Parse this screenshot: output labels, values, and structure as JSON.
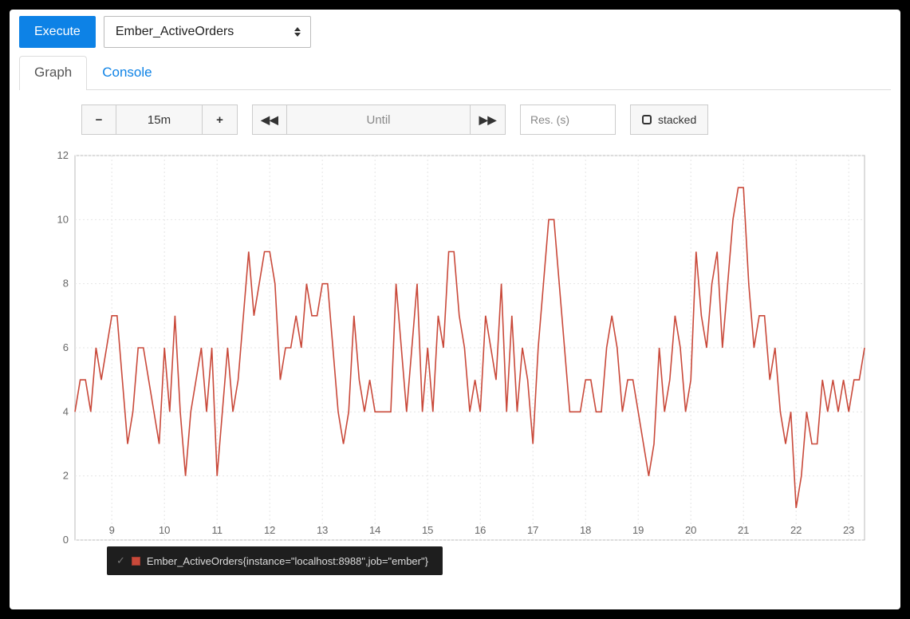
{
  "toolbar": {
    "execute_label": "Execute",
    "query_selected": "Ember_ActiveOrders"
  },
  "tabs": {
    "graph": "Graph",
    "console": "Console",
    "active": "graph"
  },
  "controls": {
    "range_value": "15m",
    "until_placeholder": "Until",
    "res_placeholder": "Res. (s)",
    "stacked_label": "stacked"
  },
  "legend": {
    "series_label": "Ember_ActiveOrders{instance=\"localhost:8988\",job=\"ember\"}"
  },
  "chart_data": {
    "type": "line",
    "title": "",
    "xlabel": "",
    "ylabel": "",
    "ylim": [
      0,
      12
    ],
    "x_ticks": [
      9,
      10,
      11,
      12,
      13,
      14,
      15,
      16,
      17,
      18,
      19,
      20,
      21,
      22,
      23
    ],
    "series": [
      {
        "name": "Ember_ActiveOrders{instance=\"localhost:8988\",job=\"ember\"}",
        "color": "#c9493a",
        "x": [
          8.3,
          8.4,
          8.5,
          8.6,
          8.7,
          8.8,
          8.9,
          9.0,
          9.1,
          9.2,
          9.3,
          9.4,
          9.5,
          9.6,
          9.7,
          9.8,
          9.9,
          10.0,
          10.1,
          10.2,
          10.3,
          10.4,
          10.5,
          10.6,
          10.7,
          10.8,
          10.9,
          11.0,
          11.1,
          11.2,
          11.3,
          11.4,
          11.5,
          11.6,
          11.7,
          11.8,
          11.9,
          12.0,
          12.1,
          12.2,
          12.3,
          12.4,
          12.5,
          12.6,
          12.7,
          12.8,
          12.9,
          13.0,
          13.1,
          13.2,
          13.3,
          13.4,
          13.5,
          13.6,
          13.7,
          13.8,
          13.9,
          14.0,
          14.1,
          14.2,
          14.3,
          14.4,
          14.5,
          14.6,
          14.7,
          14.8,
          14.9,
          15.0,
          15.1,
          15.2,
          15.3,
          15.4,
          15.5,
          15.6,
          15.7,
          15.8,
          15.9,
          16.0,
          16.1,
          16.2,
          16.3,
          16.4,
          16.5,
          16.6,
          16.7,
          16.8,
          16.9,
          17.0,
          17.1,
          17.2,
          17.3,
          17.4,
          17.5,
          17.6,
          17.7,
          17.8,
          17.9,
          18.0,
          18.1,
          18.2,
          18.3,
          18.4,
          18.5,
          18.6,
          18.7,
          18.8,
          18.9,
          19.0,
          19.1,
          19.2,
          19.3,
          19.4,
          19.5,
          19.6,
          19.7,
          19.8,
          19.9,
          20.0,
          20.1,
          20.2,
          20.3,
          20.4,
          20.5,
          20.6,
          20.7,
          20.8,
          20.9,
          21.0,
          21.1,
          21.2,
          21.3,
          21.4,
          21.5,
          21.6,
          21.7,
          21.8,
          21.9,
          22.0,
          22.1,
          22.2,
          22.3,
          22.4,
          22.5,
          22.6,
          22.7,
          22.8,
          22.9,
          23.0,
          23.1,
          23.2,
          23.3
        ],
        "values": [
          4,
          5,
          5,
          4,
          6,
          5,
          6,
          7,
          7,
          5,
          3,
          4,
          6,
          6,
          5,
          4,
          3,
          6,
          4,
          7,
          4,
          2,
          4,
          5,
          6,
          4,
          6,
          2,
          4,
          6,
          4,
          5,
          7,
          9,
          7,
          8,
          9,
          9,
          8,
          5,
          6,
          6,
          7,
          6,
          8,
          7,
          7,
          8,
          8,
          6,
          4,
          3,
          4,
          7,
          5,
          4,
          5,
          4,
          4,
          4,
          4,
          8,
          6,
          4,
          6,
          8,
          4,
          6,
          4,
          7,
          6,
          9,
          9,
          7,
          6,
          4,
          5,
          4,
          7,
          6,
          5,
          8,
          4,
          7,
          4,
          6,
          5,
          3,
          6,
          8,
          10,
          10,
          8,
          6,
          4,
          4,
          4,
          5,
          5,
          4,
          4,
          6,
          7,
          6,
          4,
          5,
          5,
          4,
          3,
          2,
          3,
          6,
          4,
          5,
          7,
          6,
          4,
          5,
          9,
          7,
          6,
          8,
          9,
          6,
          8,
          10,
          11,
          11,
          8,
          6,
          7,
          7,
          5,
          6,
          4,
          3,
          4,
          1,
          2,
          4,
          3,
          3,
          5,
          4,
          5,
          4,
          5,
          4,
          5,
          5,
          6
        ]
      }
    ]
  }
}
